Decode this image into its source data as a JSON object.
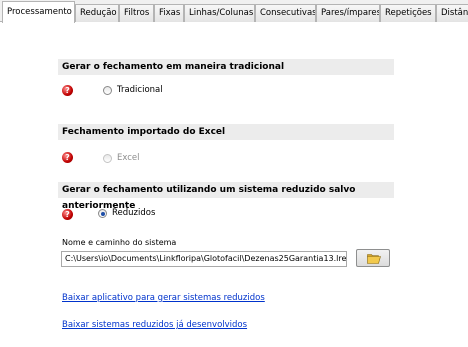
{
  "tabs": [
    "Processamento",
    "Redução",
    "Filtros",
    "Fixas",
    "Linhas/Colunas",
    "Consecutivas",
    "Pares/ímpares",
    "Repetições",
    "Distân"
  ],
  "sections": {
    "traditional": {
      "header": "Gerar o fechamento em maneira tradicional",
      "option": "Tradicional"
    },
    "excel": {
      "header": "Fechamento importado do Excel",
      "option": "Excel"
    },
    "reduced": {
      "header": "Gerar o fechamento utilizando um sistema reduzido salvo anteriormente",
      "option": "Reduzidos"
    }
  },
  "error_icon": {
    "glyph": "?",
    "icon": "error-icon",
    "color": "#c00000"
  },
  "path_field": {
    "label": "Nome e caminho do sistema",
    "value": "C:\\Users\\io\\Documents\\Linkfloripa\\Glotofacil\\Dezenas25Garantia13.lre"
  },
  "folder_button": {
    "icon": "folder-open-icon"
  },
  "links": {
    "download_app": "Baixar aplicativo para gerar sistemas reduzidos",
    "download_systems": "Baixar sistemas reduzidos já desenvolvidos"
  },
  "colors": {
    "link": "#0033cc",
    "header_bg": "#ececec",
    "selected_radio": "#1f4fa8"
  }
}
